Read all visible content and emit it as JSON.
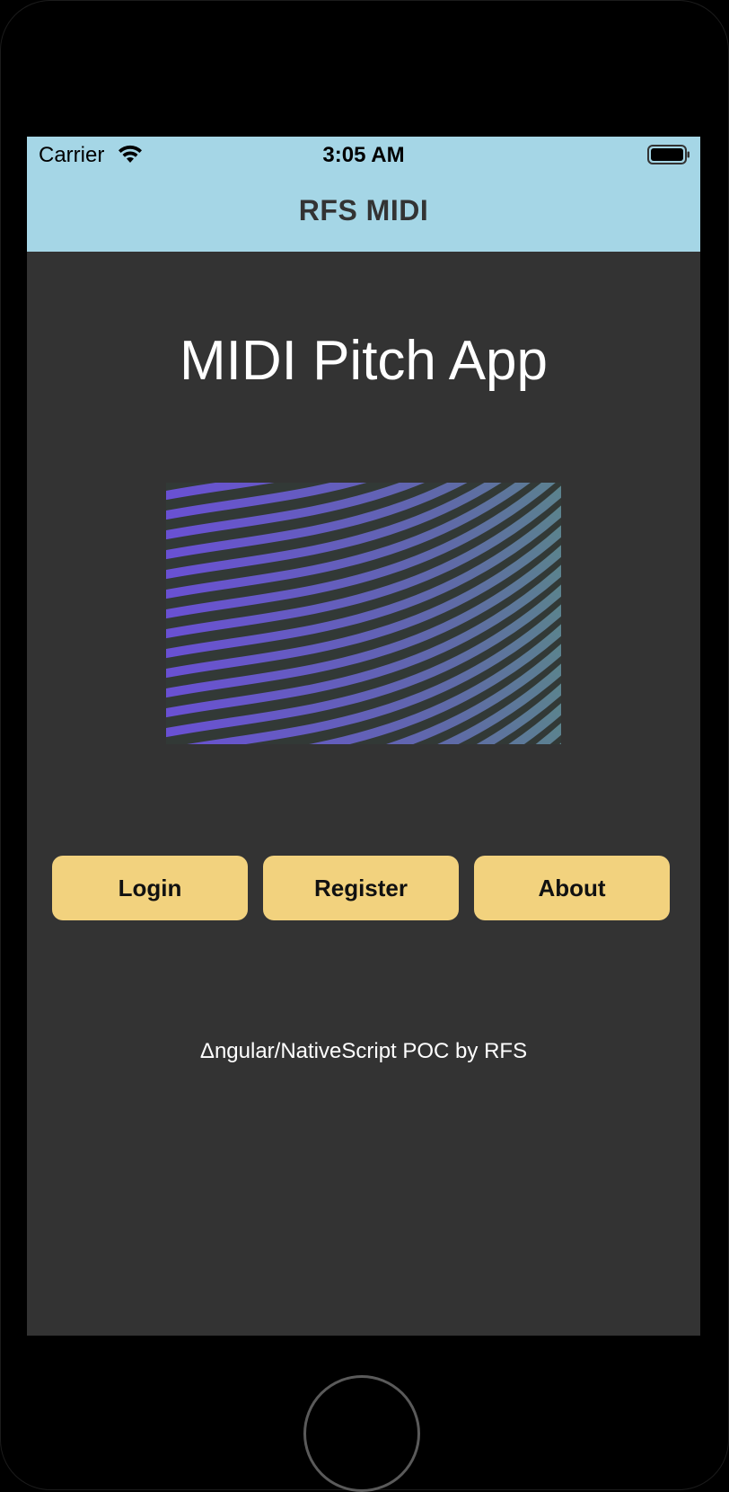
{
  "status_bar": {
    "carrier": "Carrier",
    "time": "3:05 AM",
    "wifi_icon": "wifi-icon",
    "battery_icon": "battery-icon"
  },
  "action_bar": {
    "title": "RFS MIDI",
    "background": "#a5d6e6"
  },
  "main": {
    "title": "MIDI Pitch App",
    "hero_image": "wave-pattern-image",
    "buttons": [
      {
        "label": "Login"
      },
      {
        "label": "Register"
      },
      {
        "label": "About"
      }
    ],
    "footer": "Δngular/NativeScript POC by RFS"
  },
  "colors": {
    "screen_background": "#333333",
    "button_background": "#f2d27e",
    "wave_purple": "#6a4fd6",
    "wave_teal": "#5a8a86"
  }
}
